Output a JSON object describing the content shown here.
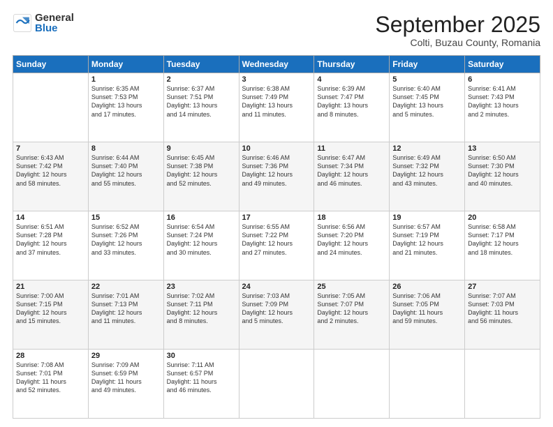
{
  "logo": {
    "general": "General",
    "blue": "Blue"
  },
  "header": {
    "month": "September 2025",
    "location": "Colti, Buzau County, Romania"
  },
  "days_of_week": [
    "Sunday",
    "Monday",
    "Tuesday",
    "Wednesday",
    "Thursday",
    "Friday",
    "Saturday"
  ],
  "weeks": [
    [
      {
        "day": "",
        "info": ""
      },
      {
        "day": "1",
        "info": "Sunrise: 6:35 AM\nSunset: 7:53 PM\nDaylight: 13 hours\nand 17 minutes."
      },
      {
        "day": "2",
        "info": "Sunrise: 6:37 AM\nSunset: 7:51 PM\nDaylight: 13 hours\nand 14 minutes."
      },
      {
        "day": "3",
        "info": "Sunrise: 6:38 AM\nSunset: 7:49 PM\nDaylight: 13 hours\nand 11 minutes."
      },
      {
        "day": "4",
        "info": "Sunrise: 6:39 AM\nSunset: 7:47 PM\nDaylight: 13 hours\nand 8 minutes."
      },
      {
        "day": "5",
        "info": "Sunrise: 6:40 AM\nSunset: 7:45 PM\nDaylight: 13 hours\nand 5 minutes."
      },
      {
        "day": "6",
        "info": "Sunrise: 6:41 AM\nSunset: 7:43 PM\nDaylight: 13 hours\nand 2 minutes."
      }
    ],
    [
      {
        "day": "7",
        "info": "Sunrise: 6:43 AM\nSunset: 7:42 PM\nDaylight: 12 hours\nand 58 minutes."
      },
      {
        "day": "8",
        "info": "Sunrise: 6:44 AM\nSunset: 7:40 PM\nDaylight: 12 hours\nand 55 minutes."
      },
      {
        "day": "9",
        "info": "Sunrise: 6:45 AM\nSunset: 7:38 PM\nDaylight: 12 hours\nand 52 minutes."
      },
      {
        "day": "10",
        "info": "Sunrise: 6:46 AM\nSunset: 7:36 PM\nDaylight: 12 hours\nand 49 minutes."
      },
      {
        "day": "11",
        "info": "Sunrise: 6:47 AM\nSunset: 7:34 PM\nDaylight: 12 hours\nand 46 minutes."
      },
      {
        "day": "12",
        "info": "Sunrise: 6:49 AM\nSunset: 7:32 PM\nDaylight: 12 hours\nand 43 minutes."
      },
      {
        "day": "13",
        "info": "Sunrise: 6:50 AM\nSunset: 7:30 PM\nDaylight: 12 hours\nand 40 minutes."
      }
    ],
    [
      {
        "day": "14",
        "info": "Sunrise: 6:51 AM\nSunset: 7:28 PM\nDaylight: 12 hours\nand 37 minutes."
      },
      {
        "day": "15",
        "info": "Sunrise: 6:52 AM\nSunset: 7:26 PM\nDaylight: 12 hours\nand 33 minutes."
      },
      {
        "day": "16",
        "info": "Sunrise: 6:54 AM\nSunset: 7:24 PM\nDaylight: 12 hours\nand 30 minutes."
      },
      {
        "day": "17",
        "info": "Sunrise: 6:55 AM\nSunset: 7:22 PM\nDaylight: 12 hours\nand 27 minutes."
      },
      {
        "day": "18",
        "info": "Sunrise: 6:56 AM\nSunset: 7:20 PM\nDaylight: 12 hours\nand 24 minutes."
      },
      {
        "day": "19",
        "info": "Sunrise: 6:57 AM\nSunset: 7:19 PM\nDaylight: 12 hours\nand 21 minutes."
      },
      {
        "day": "20",
        "info": "Sunrise: 6:58 AM\nSunset: 7:17 PM\nDaylight: 12 hours\nand 18 minutes."
      }
    ],
    [
      {
        "day": "21",
        "info": "Sunrise: 7:00 AM\nSunset: 7:15 PM\nDaylight: 12 hours\nand 15 minutes."
      },
      {
        "day": "22",
        "info": "Sunrise: 7:01 AM\nSunset: 7:13 PM\nDaylight: 12 hours\nand 11 minutes."
      },
      {
        "day": "23",
        "info": "Sunrise: 7:02 AM\nSunset: 7:11 PM\nDaylight: 12 hours\nand 8 minutes."
      },
      {
        "day": "24",
        "info": "Sunrise: 7:03 AM\nSunset: 7:09 PM\nDaylight: 12 hours\nand 5 minutes."
      },
      {
        "day": "25",
        "info": "Sunrise: 7:05 AM\nSunset: 7:07 PM\nDaylight: 12 hours\nand 2 minutes."
      },
      {
        "day": "26",
        "info": "Sunrise: 7:06 AM\nSunset: 7:05 PM\nDaylight: 11 hours\nand 59 minutes."
      },
      {
        "day": "27",
        "info": "Sunrise: 7:07 AM\nSunset: 7:03 PM\nDaylight: 11 hours\nand 56 minutes."
      }
    ],
    [
      {
        "day": "28",
        "info": "Sunrise: 7:08 AM\nSunset: 7:01 PM\nDaylight: 11 hours\nand 52 minutes."
      },
      {
        "day": "29",
        "info": "Sunrise: 7:09 AM\nSunset: 6:59 PM\nDaylight: 11 hours\nand 49 minutes."
      },
      {
        "day": "30",
        "info": "Sunrise: 7:11 AM\nSunset: 6:57 PM\nDaylight: 11 hours\nand 46 minutes."
      },
      {
        "day": "",
        "info": ""
      },
      {
        "day": "",
        "info": ""
      },
      {
        "day": "",
        "info": ""
      },
      {
        "day": "",
        "info": ""
      }
    ]
  ]
}
